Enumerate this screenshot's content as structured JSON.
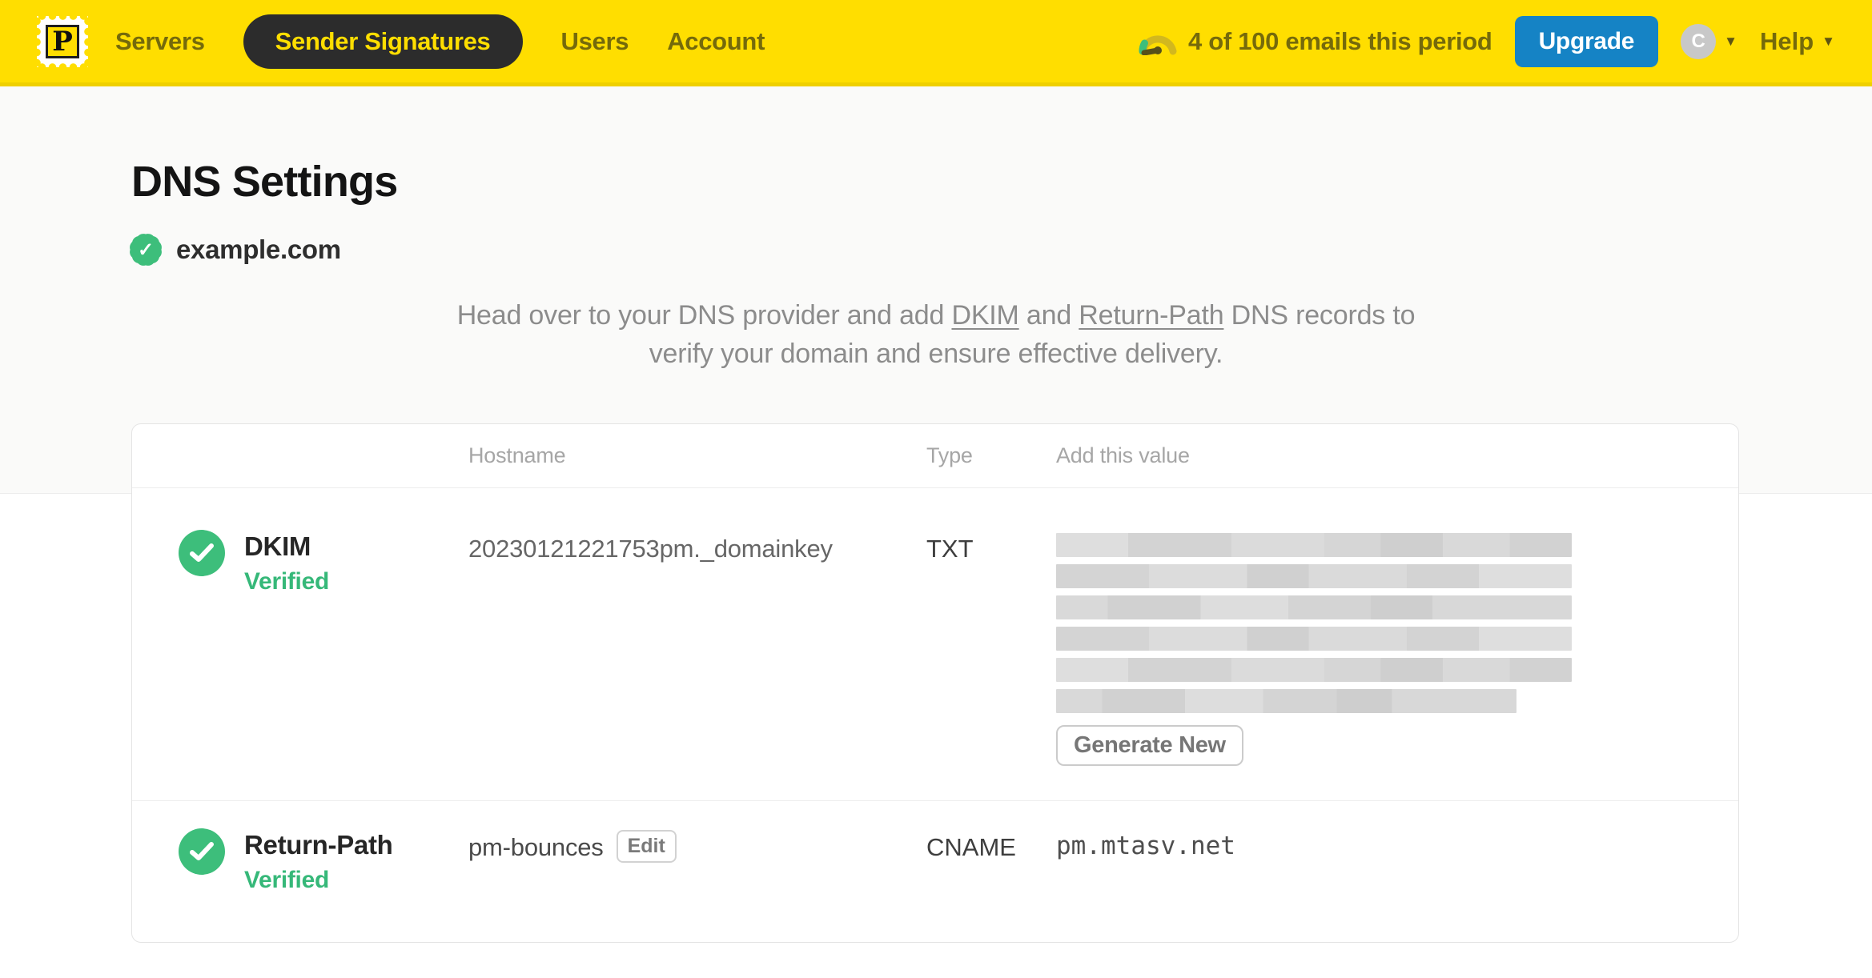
{
  "brand": {
    "colors": {
      "navbar_yellow": "#FFDE00",
      "navbar_text": "#756a0b",
      "active_pill_bg": "#2c2c2c",
      "upgrade_blue": "#1583c5",
      "verified_green": "#3dbe7b",
      "status_green_text": "#36b879"
    }
  },
  "navbar": {
    "logo_letter": "P",
    "items": [
      {
        "label": "Servers",
        "active": false
      },
      {
        "label": "Sender Signatures",
        "active": true
      },
      {
        "label": "Users",
        "active": false
      },
      {
        "label": "Account",
        "active": false
      }
    ],
    "usage_text": "4 of 100 emails this period",
    "upgrade_label": "Upgrade",
    "avatar_initial": "C",
    "help_label": "Help"
  },
  "page": {
    "title": "DNS Settings",
    "domain": "example.com",
    "intro": {
      "part1": "Head over to your DNS provider and add ",
      "link1": "DKIM",
      "mid": " and ",
      "link2": "Return-Path",
      "part2": " DNS records to verify your domain and ensure effective delivery."
    }
  },
  "table": {
    "headers": {
      "hostname": "Hostname",
      "type": "Type",
      "value": "Add this value"
    },
    "rows": [
      {
        "name": "DKIM",
        "status": "Verified",
        "hostname": "20230121221753pm._domainkey",
        "type": "TXT",
        "value_redacted": true,
        "redacted_line_count": 6,
        "action_label": "Generate New"
      },
      {
        "name": "Return-Path",
        "status": "Verified",
        "hostname": "pm-bounces",
        "edit_label": "Edit",
        "type": "CNAME",
        "value": "pm.mtasv.net"
      }
    ]
  }
}
